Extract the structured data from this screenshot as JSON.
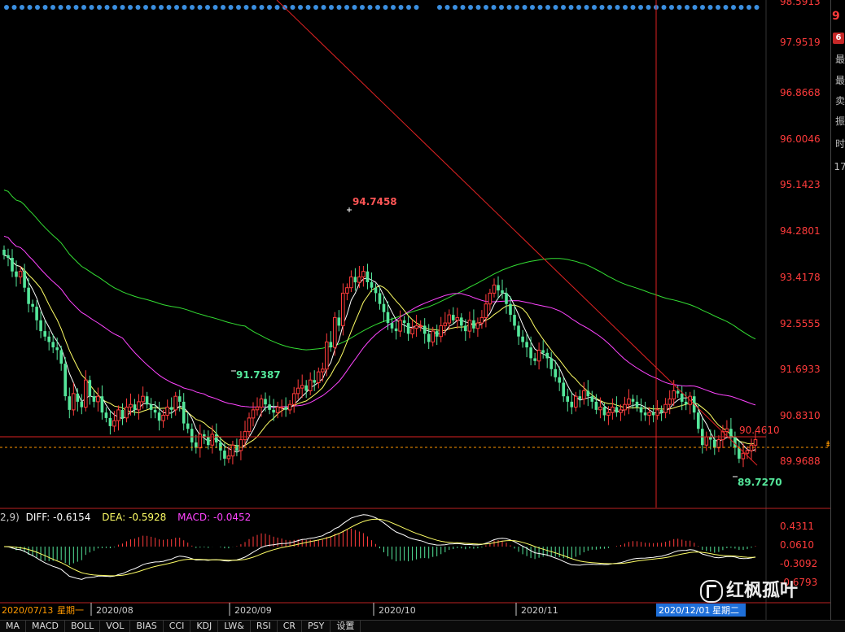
{
  "chart_data": {
    "type": "candlestick",
    "price_axis": {
      "ticks": [
        "98.5913",
        "97.9519",
        "96.8668",
        "96.0046",
        "95.1423",
        "94.2801",
        "93.4178",
        "92.5555",
        "91.6933",
        "90.8310",
        "89.9688"
      ],
      "range": [
        89.25,
        98.6
      ]
    },
    "x_axis": {
      "ticks": [
        "2020/08",
        "2020/09",
        "2020/10",
        "2020/11"
      ],
      "start_label": "2020/07/13",
      "start_weekday": "星期一",
      "cursor_date": "2020/12/01",
      "cursor_weekday": "星期二"
    },
    "annotations": {
      "high_label": "94.7458",
      "low_label_1": "91.7387",
      "low_label_2": "89.7270",
      "price_line_label": "90.4610"
    },
    "indicator": {
      "params_prefix": "2,9)",
      "diff_label": "DIFF:",
      "diff_value": "-0.6154",
      "dea_label": "DEA:",
      "dea_value": "-0.5928",
      "macd_label": "MACD:",
      "macd_value": "-0.0452",
      "ticks": [
        "0.4311",
        "0.0610",
        "-0.3092",
        "-0.6793"
      ]
    },
    "closes": [
      93.9,
      93.85,
      93.6,
      93.5,
      93.6,
      93.3,
      93.0,
      92.95,
      92.7,
      92.5,
      92.4,
      92.3,
      92.2,
      92.15,
      91.9,
      91.3,
      91.05,
      91.35,
      91.2,
      91.1,
      91.6,
      91.3,
      91.2,
      91.3,
      91.0,
      90.9,
      90.75,
      90.85,
      91.05,
      90.9,
      91.1,
      91.15,
      91.05,
      91.2,
      91.3,
      91.15,
      91.05,
      91.0,
      90.85,
      90.95,
      91.1,
      91.05,
      91.3,
      91.2,
      90.8,
      90.7,
      90.45,
      90.35,
      90.6,
      90.55,
      90.4,
      90.6,
      90.45,
      90.3,
      90.15,
      90.2,
      90.4,
      90.3,
      90.5,
      90.65,
      90.9,
      91.05,
      91.1,
      91.25,
      91.15,
      91.05,
      91.0,
      91.1,
      91.1,
      91.05,
      91.15,
      91.35,
      91.45,
      91.5,
      91.4,
      91.6,
      91.55,
      91.75,
      91.8,
      92.3,
      92.2,
      92.75,
      92.6,
      93.2,
      93.3,
      93.5,
      93.4,
      93.5,
      93.6,
      93.4,
      93.3,
      93.2,
      93.0,
      92.85,
      92.65,
      92.55,
      92.5,
      92.7,
      92.65,
      92.45,
      92.55,
      92.6,
      92.6,
      92.45,
      92.3,
      92.5,
      92.4,
      92.6,
      92.65,
      92.8,
      92.7,
      92.75,
      92.6,
      92.5,
      92.7,
      92.55,
      92.65,
      92.75,
      93.0,
      93.2,
      93.35,
      93.25,
      93.2,
      93.0,
      92.8,
      92.6,
      92.4,
      92.3,
      92.2,
      92.0,
      91.95,
      92.15,
      92.1,
      92.0,
      91.8,
      91.65,
      91.55,
      91.3,
      91.2,
      91.1,
      91.3,
      91.25,
      91.4,
      91.3,
      91.2,
      91.05,
      91.1,
      90.95,
      91.0,
      91.1,
      91.0,
      91.05,
      91.15,
      91.25,
      91.2,
      91.1,
      91.0,
      90.95,
      91.0,
      90.95,
      91.05,
      91.0,
      91.15,
      91.25,
      91.4,
      91.35,
      91.2,
      91.15,
      91.3,
      91.0,
      90.7,
      90.4,
      90.55,
      90.5,
      90.35,
      90.5,
      90.65,
      90.7,
      90.55,
      90.35,
      90.15,
      90.25,
      90.3,
      90.4,
      90.5
    ]
  },
  "tabs": [
    "MA",
    "MACD",
    "BOLL",
    "VOL",
    "BIAS",
    "CCI",
    "KDJ",
    "LW&",
    "RSI",
    "CR",
    "PSY",
    "设置"
  ],
  "right_panel": {
    "badge": "9",
    "badge2": "6",
    "items": [
      "最",
      "最",
      "卖",
      "振",
      "时",
      "17"
    ]
  },
  "watermark": "红枫孤叶",
  "colors": {
    "up": "#ff3b3b",
    "down": "#54e69a",
    "ma_short": "#ffffff",
    "ma_mid": "#ffff66",
    "ma_long1": "#ff44ff",
    "ma_long2": "#33dd33",
    "trendline": "#dd2222",
    "price_level": "#ff9900",
    "axis_text_price": "#ff3b3b",
    "axis_text_macd": "#ff3b3b"
  }
}
